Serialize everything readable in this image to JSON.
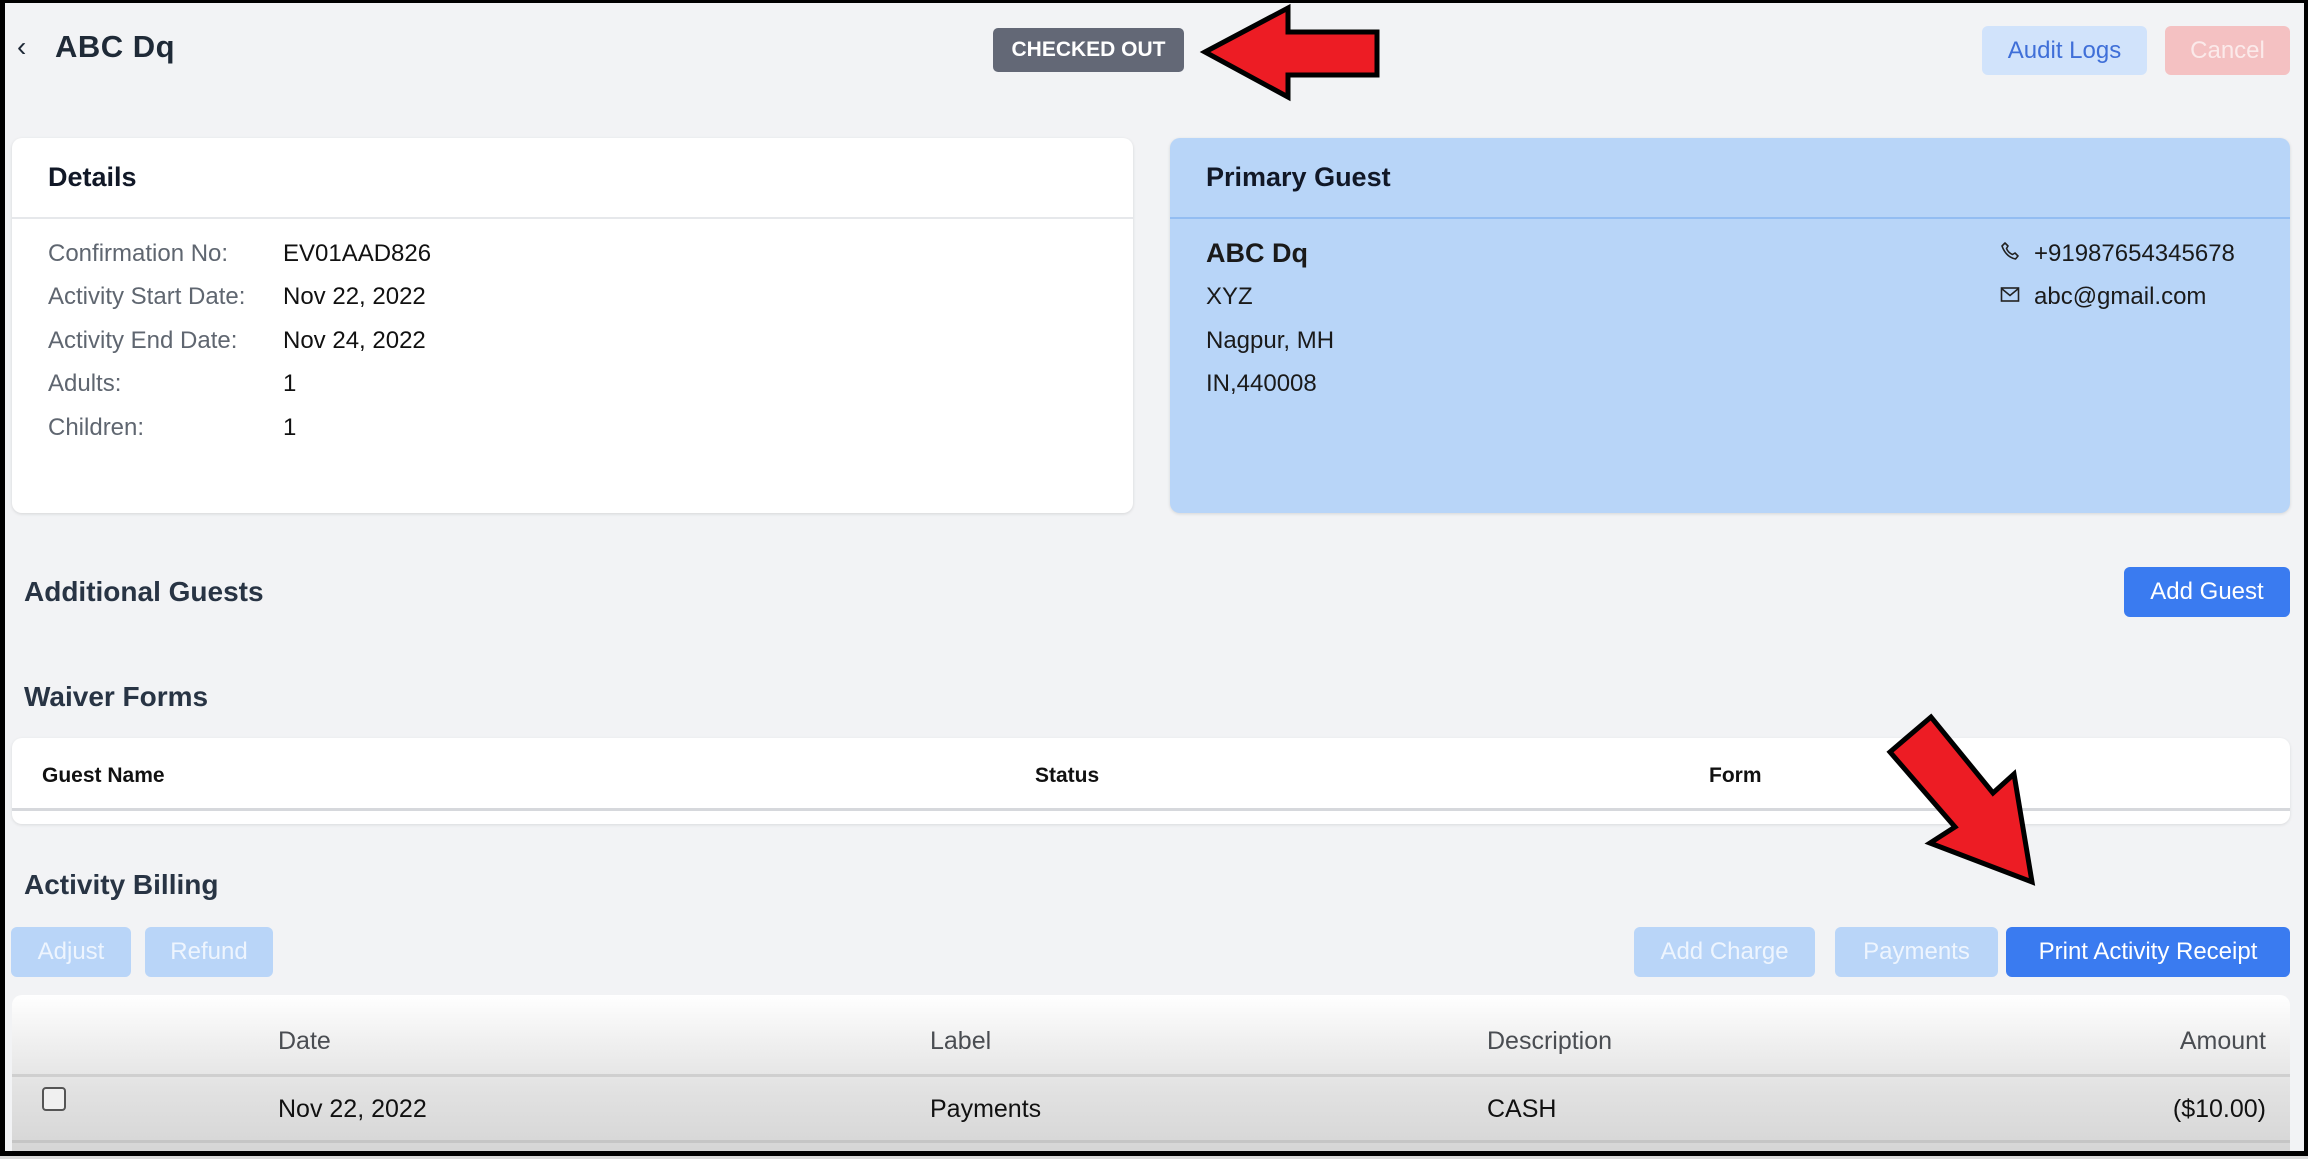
{
  "header": {
    "back_icon": "chevron-left-icon",
    "title": "ABC  Dq",
    "status_badge": "CHECKED OUT",
    "audit_logs_label": "Audit Logs",
    "cancel_label": "Cancel"
  },
  "details": {
    "title": "Details",
    "rows": [
      {
        "label": "Confirmation No:",
        "value": "EV01AAD826"
      },
      {
        "label": "Activity Start Date:",
        "value": "Nov 22, 2022"
      },
      {
        "label": "Activity End Date:",
        "value": "Nov 24, 2022"
      },
      {
        "label": "Adults:",
        "value": "1"
      },
      {
        "label": "Children:",
        "value": "1"
      }
    ]
  },
  "primary_guest": {
    "title": "Primary Guest",
    "name": "ABC  Dq",
    "address_line1": "XYZ",
    "address_line2": "Nagpur, MH",
    "address_line3": "IN,440008",
    "phone_icon": "phone-icon",
    "phone": "+91987654345678",
    "email_icon": "mail-icon",
    "email": "abc@gmail.com"
  },
  "additional_guests": {
    "title": "Additional Guests",
    "add_guest_label": "Add Guest"
  },
  "waiver_forms": {
    "title": "Waiver Forms",
    "columns": [
      "Guest Name",
      "Status",
      "Form"
    ],
    "rows": []
  },
  "activity_billing": {
    "title": "Activity Billing",
    "buttons": {
      "adjust": "Adjust",
      "refund": "Refund",
      "add_charge": "Add Charge",
      "payments": "Payments",
      "print_receipt": "Print Activity Receipt"
    },
    "columns": [
      "",
      "Date",
      "Label",
      "Description",
      "Amount"
    ],
    "rows": [
      {
        "checked": false,
        "date": "Nov 22, 2022",
        "label": "Payments",
        "description": "CASH",
        "amount": "($10.00)"
      }
    ]
  },
  "annotations": {
    "arrow_color": "#ed1c24",
    "arrows": [
      "arrow pointing to status badge",
      "arrow pointing to Print Activity Receipt button"
    ]
  },
  "colors": {
    "primary": "#3a7bf0",
    "badge_bg": "#636876",
    "guest_card_bg": "#b8d5f8",
    "page_bg": "#f2f3f5"
  }
}
